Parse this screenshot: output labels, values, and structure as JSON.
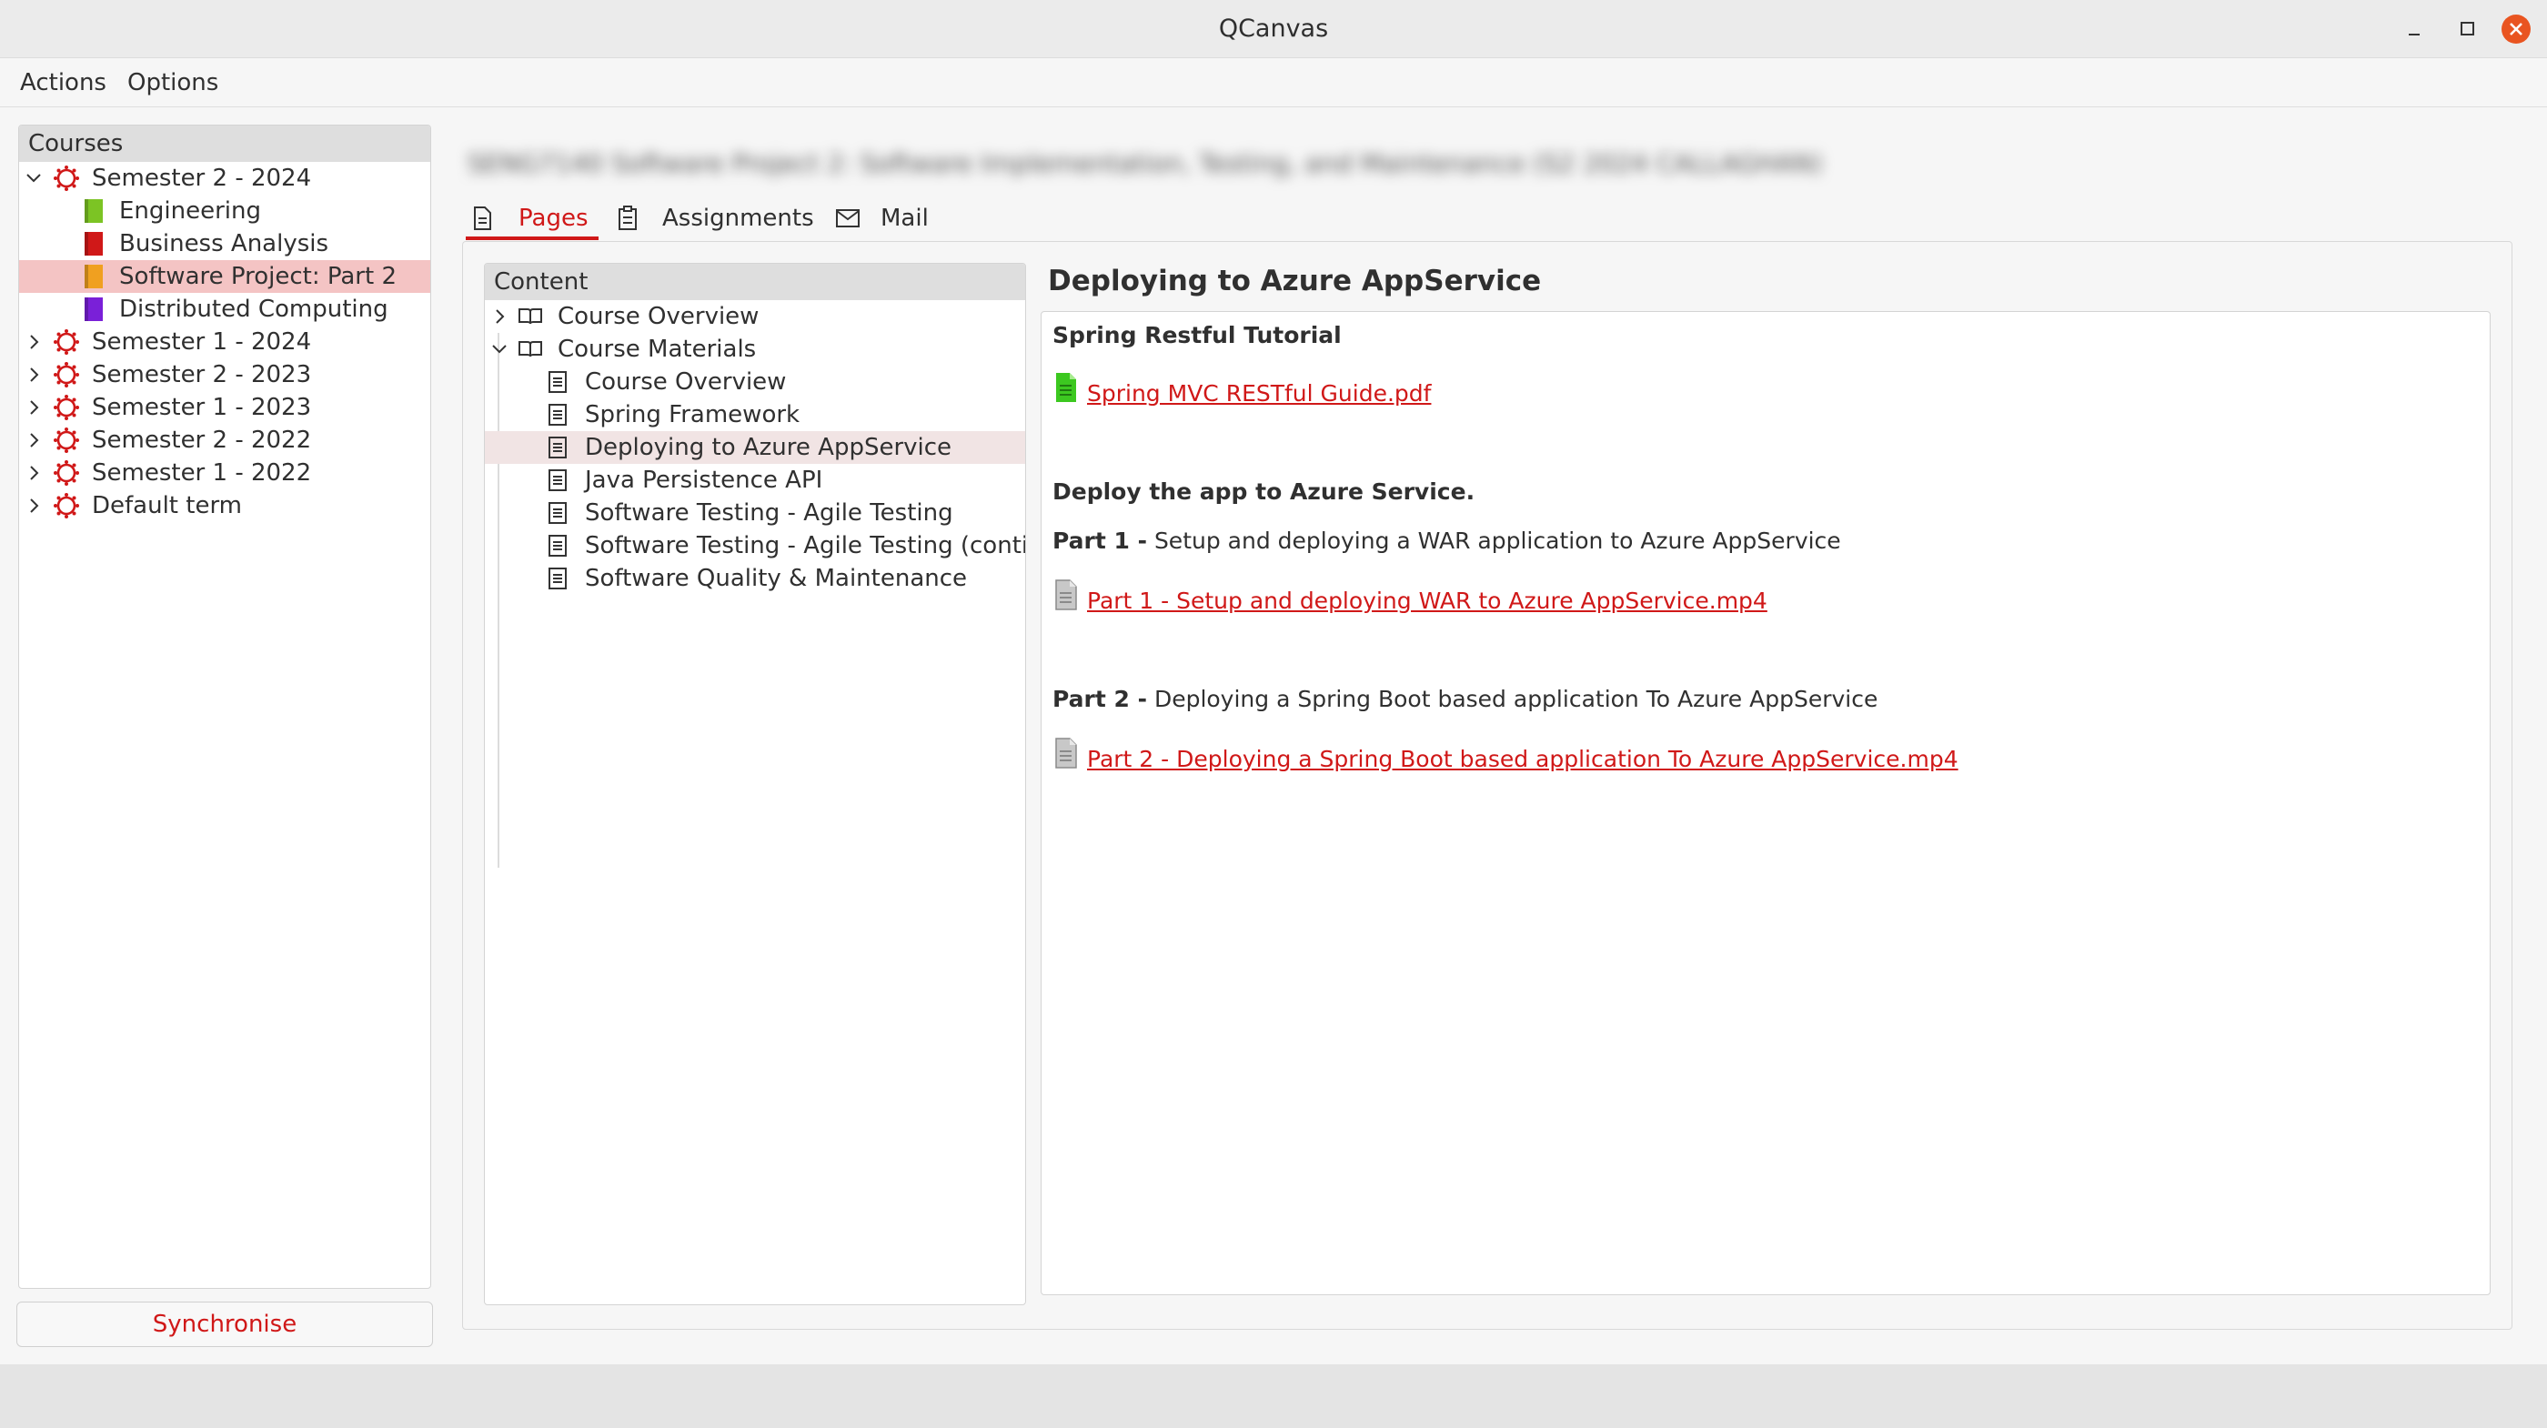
{
  "window": {
    "title": "QCanvas"
  },
  "menu": {
    "items": [
      "Actions",
      "Options"
    ]
  },
  "courses": {
    "header": "Courses",
    "rows": [
      {
        "label": "Semester 2 - 2024",
        "kind": "term",
        "expanded": true
      },
      {
        "label": "Engineering",
        "kind": "course",
        "color": "#7cc424"
      },
      {
        "label": "Business Analysis",
        "kind": "course",
        "color": "#d01818"
      },
      {
        "label": "Software Project: Part 2",
        "kind": "course",
        "color": "#f0a020",
        "selected": true
      },
      {
        "label": "Distributed Computing",
        "kind": "course",
        "color": "#7a20d8"
      },
      {
        "label": "Semester 1 - 2024",
        "kind": "term",
        "expanded": false
      },
      {
        "label": "Semester 2 - 2023",
        "kind": "term",
        "expanded": false
      },
      {
        "label": "Semester 1 - 2023",
        "kind": "term",
        "expanded": false
      },
      {
        "label": "Semester 2 - 2022",
        "kind": "term",
        "expanded": false
      },
      {
        "label": "Semester 1 - 2022",
        "kind": "term",
        "expanded": false
      },
      {
        "label": "Default term",
        "kind": "term",
        "expanded": false
      }
    ],
    "sync_label": "Synchronise"
  },
  "course_title": "SENG7140 Software Project 2: Software Implementation, Testing, and Maintenance (S2 2024 CALLAGHAN)",
  "tabs": [
    {
      "label": "Pages",
      "icon": "page-icon",
      "active": true
    },
    {
      "label": "Assignments",
      "icon": "assignment-icon",
      "active": false
    },
    {
      "label": "Mail",
      "icon": "mail-icon",
      "active": false
    }
  ],
  "content": {
    "header": "Content",
    "rows": [
      {
        "label": "Course Overview",
        "kind": "module",
        "expanded": false
      },
      {
        "label": "Course Materials",
        "kind": "module",
        "expanded": true
      },
      {
        "label": "Course Overview",
        "kind": "page"
      },
      {
        "label": "Spring Framework",
        "kind": "page"
      },
      {
        "label": "Deploying to Azure AppService",
        "kind": "page",
        "selected": true
      },
      {
        "label": "Java Persistence API",
        "kind": "page"
      },
      {
        "label": "Software Testing - Agile Testing",
        "kind": "page"
      },
      {
        "label": "Software Testing - Agile Testing (conti…",
        "kind": "page"
      },
      {
        "label": "Software Quality & Maintenance",
        "kind": "page"
      }
    ]
  },
  "page": {
    "title": "Deploying to Azure AppService",
    "section1_heading": "Spring Restful Tutorial",
    "link1": "Spring MVC RESTful Guide.pdf",
    "section2_heading": "Deploy the app to Azure Service.",
    "part1_prefix": "Part 1 -",
    "part1_text": "Setup and deploying a WAR application to Azure AppService",
    "link2": "Part 1 - Setup and deploying WAR to Azure AppService.mp4",
    "part2_prefix": "Part 2 -",
    "part2_text": "Deploying a Spring Boot based application To Azure AppService",
    "link3": "Part 2 - Deploying a Spring Boot based application To Azure AppService.mp4"
  },
  "colors": {
    "accent": "#d01818",
    "selection": "#f4c4c4",
    "pdf_icon": "#3cc820",
    "video_icon": "#9a9a9a"
  }
}
